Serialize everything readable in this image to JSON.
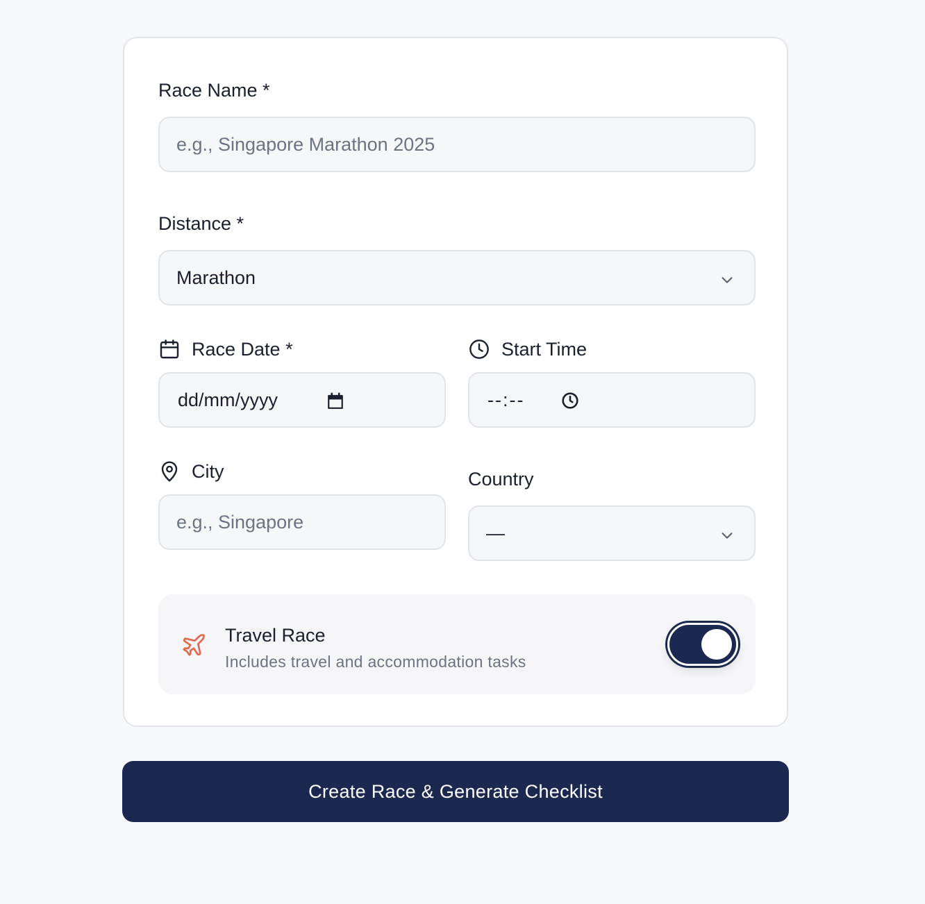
{
  "form": {
    "race_name": {
      "label": "Race Name *",
      "placeholder": "e.g., Singapore Marathon 2025",
      "value": ""
    },
    "distance": {
      "label": "Distance *",
      "value": "Marathon"
    },
    "race_date": {
      "label": "Race Date *",
      "placeholder": "dd/mm/yyyy"
    },
    "start_time": {
      "label": "Start Time",
      "placeholder": "--:--"
    },
    "city": {
      "label": "City",
      "placeholder": "e.g., Singapore",
      "value": ""
    },
    "country": {
      "label": "Country",
      "value": "—"
    },
    "travel_race": {
      "title": "Travel Race",
      "subtitle": "Includes travel and accommodation tasks",
      "enabled": true
    }
  },
  "submit_label": "Create Race & Generate Checklist",
  "colors": {
    "primary": "#1b2950",
    "accent_plane": "#e06a4e",
    "background": "#f7f8fa"
  },
  "icons": [
    "calendar-icon",
    "clock-icon",
    "map-pin-icon",
    "plane-icon",
    "chevron-down-icon"
  ]
}
